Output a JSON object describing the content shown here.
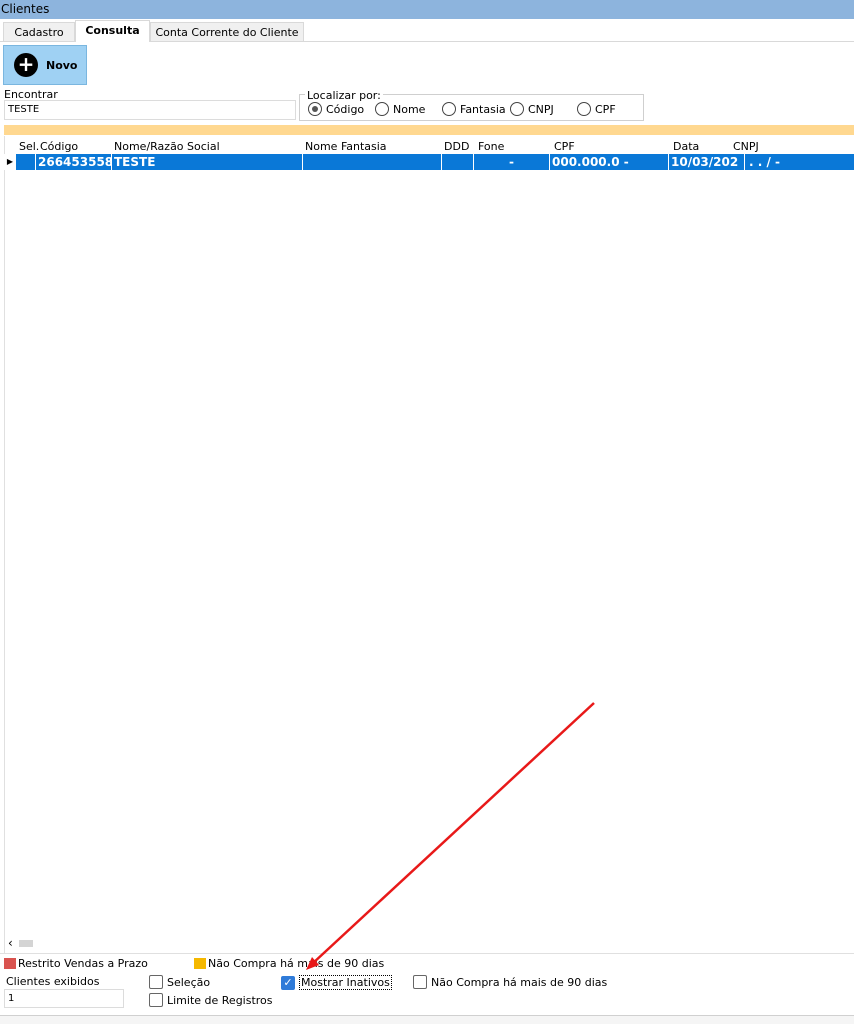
{
  "window": {
    "title": "Clientes"
  },
  "tabs": [
    {
      "label": "Cadastro"
    },
    {
      "label": "Consulta"
    },
    {
      "label": "Conta Corrente do Cliente"
    }
  ],
  "toolbar": {
    "novo_label": "Novo"
  },
  "search": {
    "encontrar_label": "Encontrar",
    "encontrar_value": "TESTE",
    "localizar_label": "Localizar por:",
    "options": [
      "Código",
      "Nome",
      "Fantasia",
      "CNPJ",
      "CPF"
    ],
    "selected": "Código"
  },
  "grid": {
    "columns": [
      "Sel.",
      "Código",
      "Nome/Razão Social",
      "Nome Fantasia",
      "DDD",
      "Fone",
      "CPF",
      "Data",
      "CNPJ"
    ],
    "rows": [
      {
        "sel": "",
        "codigo": "266453558",
        "nome": "TESTE",
        "fantasia": "",
        "ddd": "",
        "fone": "-",
        "cpf": "000.000.0  -",
        "data": "10/03/202",
        "cnpj": ".  .  /  -"
      }
    ]
  },
  "legend": {
    "restrito": "Restrito Vendas a Prazo",
    "nao_compra": "Não Compra há mais de 90 dias",
    "restrito_color": "#d9534f",
    "nao_compra_color": "#f5b800"
  },
  "footer": {
    "clientes_exibidos_label": "Clientes exibidos",
    "clientes_exibidos_value": "1",
    "selecao_label": "Seleção",
    "limite_label": "Limite de Registros",
    "mostrar_inativos_label": "Mostrar Inativos",
    "nao_compra_label": "Não Compra há mais de 90 dias"
  }
}
